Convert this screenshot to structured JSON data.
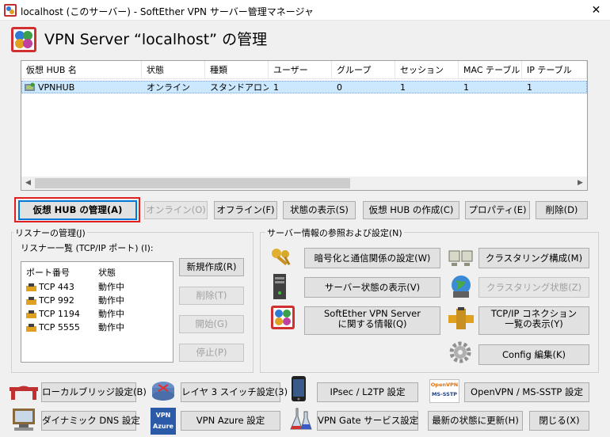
{
  "window": {
    "title": "localhost (このサーバー) - SoftEther VPN サーバー管理マネージャ",
    "close": "✕"
  },
  "heading": "VPN Server “localhost” の管理",
  "hub_list": {
    "columns": [
      "仮想 HUB 名",
      "状態",
      "種類",
      "ユーザー",
      "グループ",
      "セッション",
      "MAC テーブル",
      "IP テーブル"
    ],
    "rows": [
      [
        "VPNHUB",
        "オンライン",
        "スタンドアロン",
        "1",
        "0",
        "1",
        "1",
        "1"
      ]
    ]
  },
  "hub_buttons": {
    "manage": "仮想 HUB の管理(A)",
    "online": "オンライン(O)",
    "offline": "オフライン(F)",
    "status": "状態の表示(S)",
    "create": "仮想 HUB の作成(C)",
    "properties": "プロパティ(E)",
    "delete": "削除(D)"
  },
  "listener": {
    "group_title": "リスナーの管理(J)",
    "list_label": "リスナー一覧 (TCP/IP ポート) (I):",
    "columns": [
      "ポート番号",
      "状態"
    ],
    "rows": [
      [
        "TCP 443",
        "動作中"
      ],
      [
        "TCP 992",
        "動作中"
      ],
      [
        "TCP 1194",
        "動作中"
      ],
      [
        "TCP 5555",
        "動作中"
      ]
    ],
    "buttons": {
      "new": "新規作成(R)",
      "delete": "削除(T)",
      "start": "開始(G)",
      "stop": "停止(P)"
    }
  },
  "server_info": {
    "group_title": "サーバー情報の参照および設定(N)",
    "encryption": "暗号化と通信関係の設定(W)",
    "cluster_config": "クラスタリング構成(M)",
    "server_status": "サーバー状態の表示(V)",
    "cluster_status": "クラスタリング状態(Z)",
    "about_line1": "SoftEther VPN Server",
    "about_line2": "に関する情報(Q)",
    "tcp_line1": "TCP/IP コネクション",
    "tcp_line2": "一覧の表示(Y)",
    "config": "Config 編集(K)"
  },
  "bottom": {
    "local_bridge": "ローカルブリッジ設定(B)",
    "layer3": "レイヤ 3 スイッチ設定(3)",
    "ipsec": "IPsec / L2TP 設定",
    "openvpn": "OpenVPN / MS-SSTP 設定",
    "ddns": "ダイナミック DNS 設定",
    "azure": "VPN Azure 設定",
    "vpngate": "VPN Gate サービス設定",
    "refresh": "最新の状態に更新(H)",
    "close": "閉じる(X)"
  },
  "badges": {
    "openvpn_top": "OpenVPN",
    "openvpn_bottom": "MS-SSTP",
    "azure_top": "VPN",
    "azure_bottom": "Azure"
  },
  "colors": {
    "accent": "#0078d7",
    "highlight": "#cce8ff",
    "red_box": "#e02020",
    "online_green": "#3a9a3a"
  }
}
